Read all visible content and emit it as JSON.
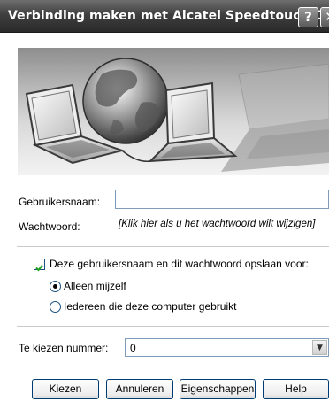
{
  "window": {
    "title": "Verbinding maken met Alcatel Speedtouch C...",
    "help_button": "?",
    "close_button": "✕"
  },
  "form": {
    "username_label": "Gebruikersnaam:",
    "username_value": "",
    "password_label": "Wachtwoord:",
    "password_hint": "[Klik hier als u het wachtwoord wilt wijzigen]",
    "save_checkbox_label": "Deze gebruikersnaam en dit wachtwoord opslaan voor:",
    "save_checkbox_checked": true,
    "radio_only_me": "Alleen mijzelf",
    "radio_everyone": "Iedereen die deze computer gebruikt",
    "radio_selected": "only_me",
    "dial_number_label": "Te kiezen nummer:",
    "dial_number_value": "0"
  },
  "buttons": {
    "dial": "Kiezen",
    "cancel": "Annuleren",
    "properties": "Eigenschappen",
    "help": "Help"
  },
  "icons": {
    "banner": "network-connection-illustration",
    "dropdown": "chevron-down-icon"
  }
}
